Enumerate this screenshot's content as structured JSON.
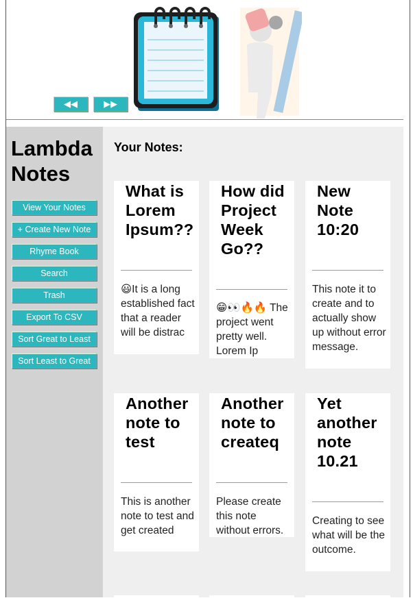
{
  "header": {
    "prev_label": "◀◀",
    "next_label": "▶▶"
  },
  "sidebar": {
    "title_line1": "Lambda",
    "title_line2": "Notes",
    "buttons": [
      {
        "label": "View Your Notes"
      },
      {
        "label": "+ Create New Note"
      },
      {
        "label": "Rhyme Book"
      },
      {
        "label": "Search"
      },
      {
        "label": "Trash"
      },
      {
        "label": "Export To CSV"
      },
      {
        "label": "Sort Great to Least"
      },
      {
        "label": "Sort Least to Great"
      }
    ]
  },
  "main": {
    "title": "Your Notes:",
    "notes": [
      {
        "title": "What is Lorem Ipsum??",
        "body": "😃It is a long established fact that a reader will be distrac"
      },
      {
        "title": "How did Project Week Go??",
        "body": "😁👀🔥🔥 The project went pretty well. Lorem Ip"
      },
      {
        "title": "New Note 10:20",
        "body": "This note it to create and to actually show up without error message."
      },
      {
        "title": "Another note to test",
        "body": "This is another note to test and get created"
      },
      {
        "title": "Another note to createq",
        "body": "Please create this note without errors."
      },
      {
        "title": "Yet another note 10.21",
        "body": "Creating to see what will be the outcome."
      }
    ]
  },
  "colors": {
    "accent": "#2bb7bd",
    "sidebar_bg": "#d2d2d2",
    "main_bg": "#efefef"
  }
}
